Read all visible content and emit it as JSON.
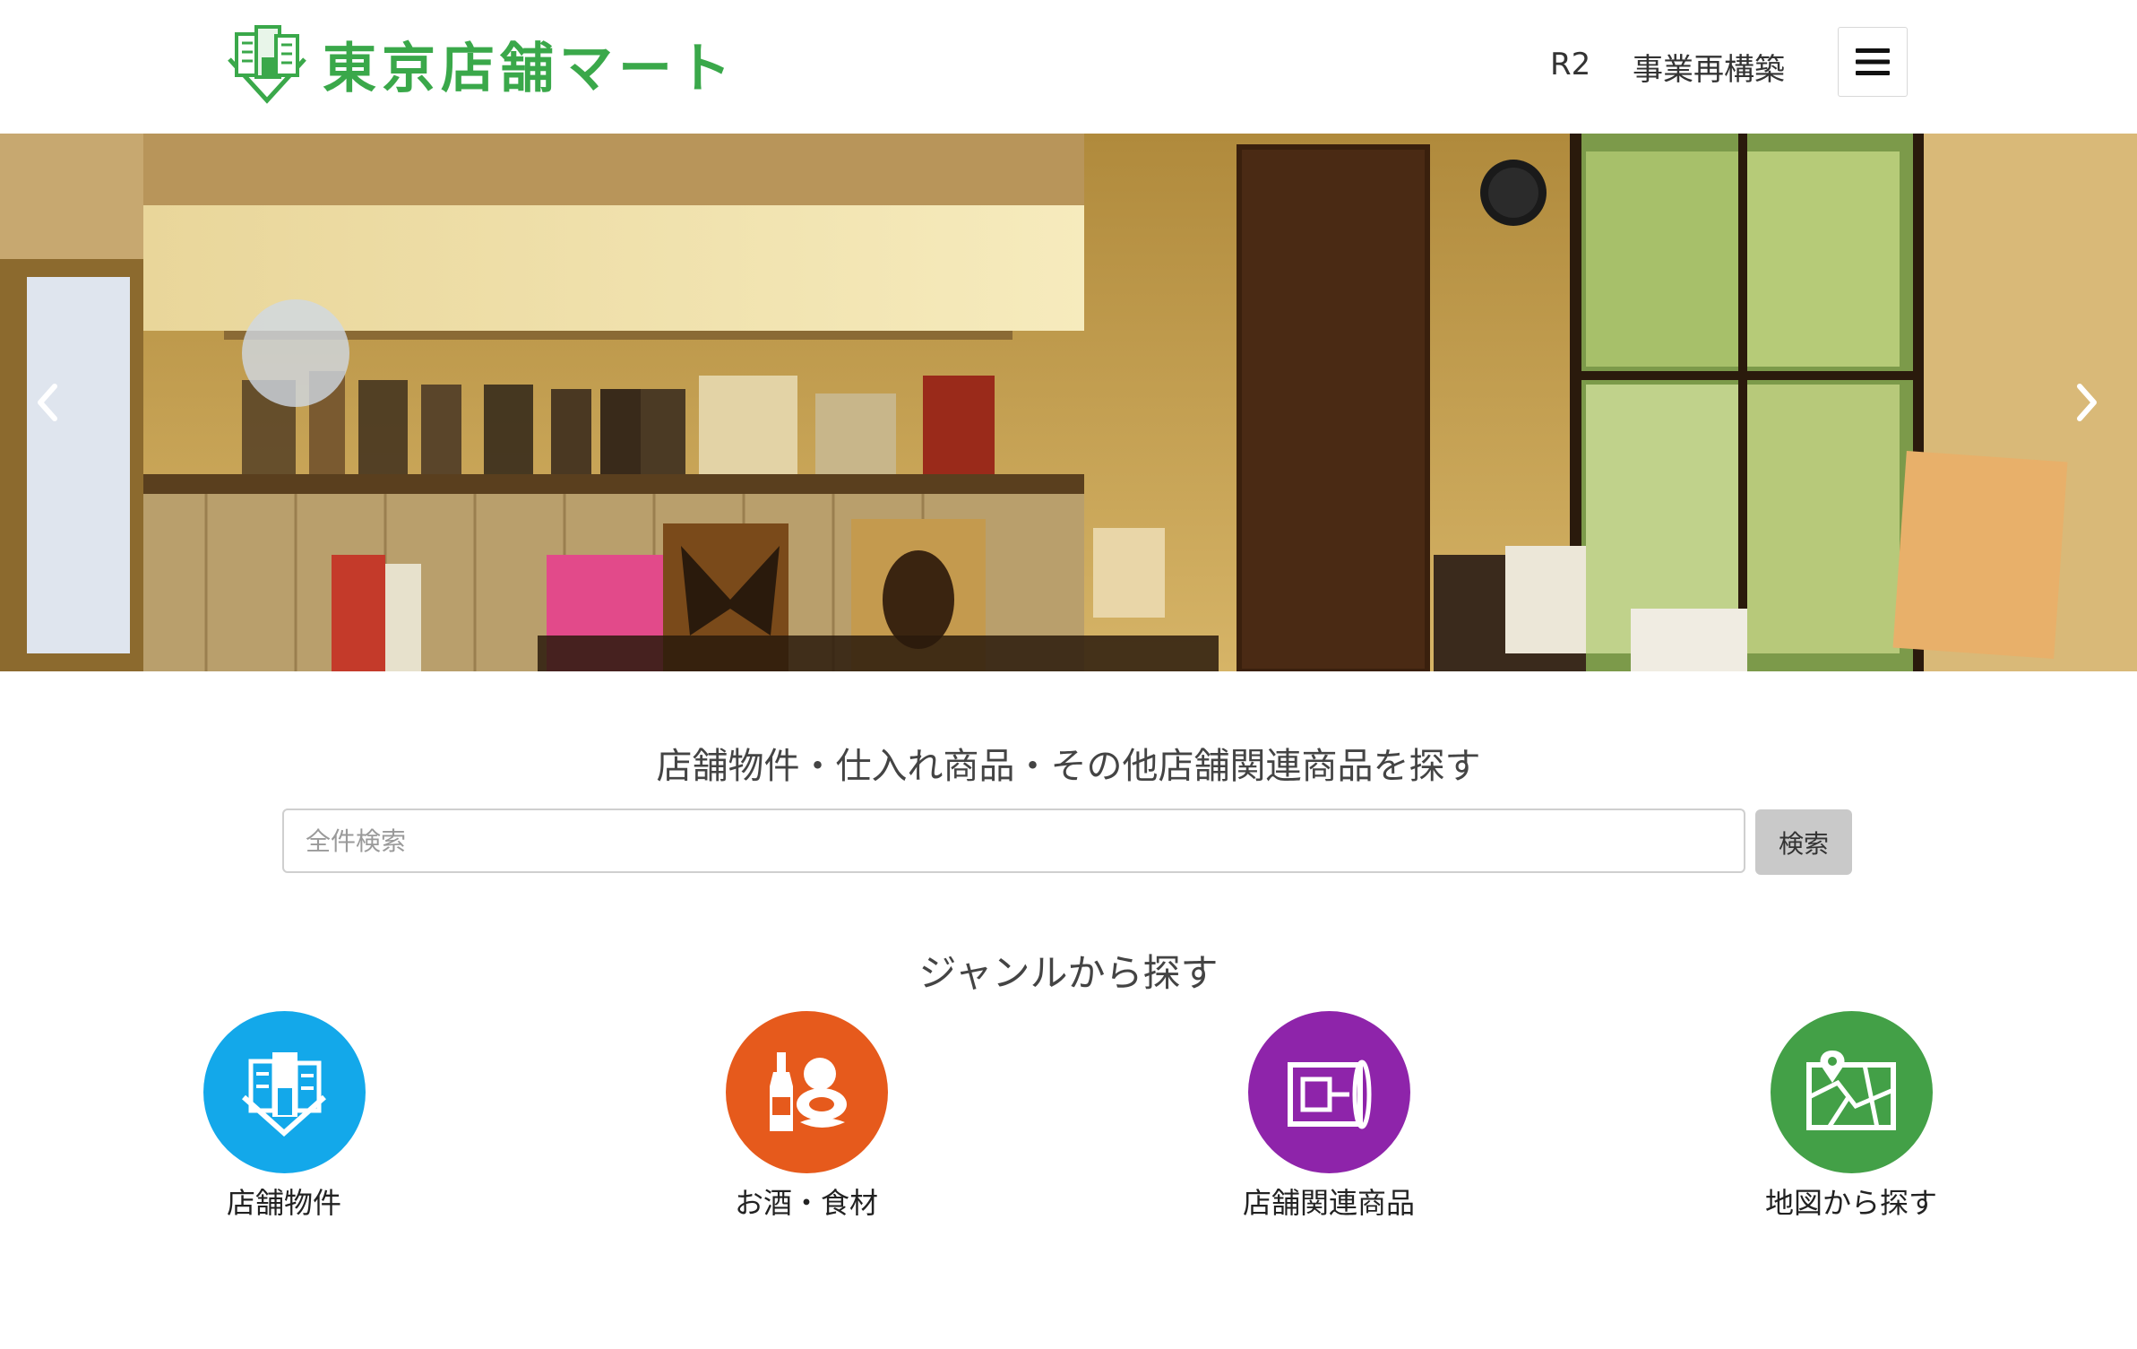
{
  "header": {
    "logo_text": "東京店舗マート",
    "nav": [
      {
        "label": "R2"
      },
      {
        "label": "事業再構築"
      }
    ],
    "menu_icon": "hamburger-icon"
  },
  "hero": {
    "prev_icon": "chevron-left-icon",
    "next_icon": "chevron-right-icon"
  },
  "search": {
    "heading": "店舗物件・仕入れ商品・その他店舗関連商品を探す",
    "placeholder": "全件検索",
    "button_label": "検索"
  },
  "genre": {
    "heading": "ジャンルから探す",
    "items": [
      {
        "label": "店舗物件",
        "icon": "buildings-icon",
        "color": "#13a8ea"
      },
      {
        "label": "お酒・食材",
        "icon": "wine-food-icon",
        "color": "#e65a1c"
      },
      {
        "label": "店舗関連商品",
        "icon": "floor-plan-icon",
        "color": "#8e24aa"
      },
      {
        "label": "地図から探す",
        "icon": "map-icon",
        "color": "#43a047"
      }
    ]
  }
}
